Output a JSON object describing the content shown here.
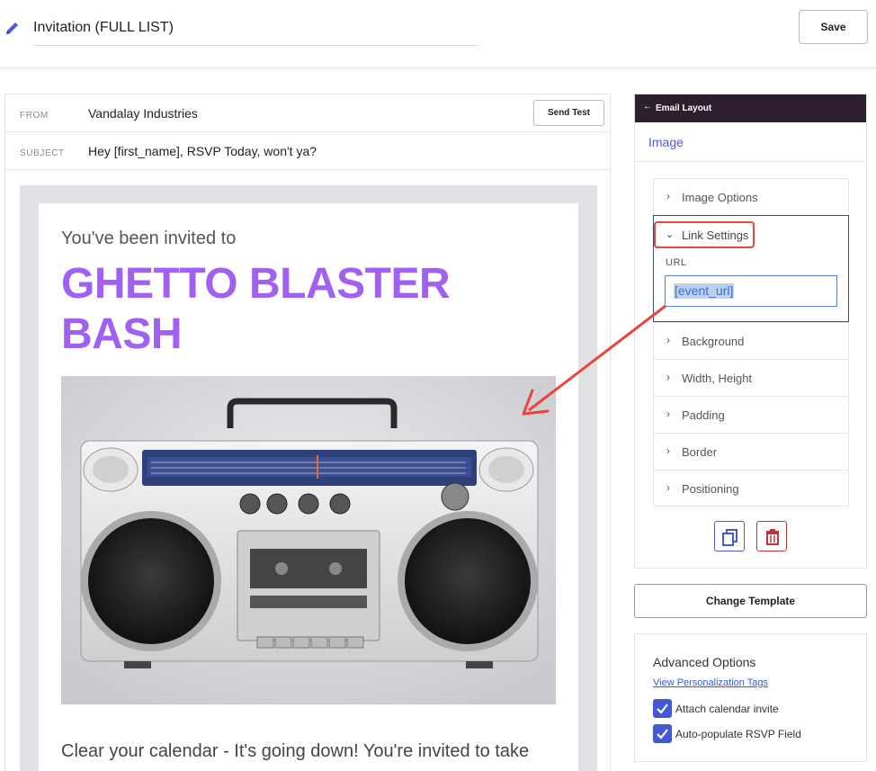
{
  "header": {
    "title": "Invitation (FULL LIST)",
    "save_label": "Save"
  },
  "email": {
    "from_label": "FROM",
    "from_value": "Vandalay Industries",
    "subject_label": "SUBJECT",
    "subject_value": "Hey [first_name], RSVP Today, won't ya?",
    "send_test_label": "Send Test"
  },
  "preview": {
    "intro": "You've been invited to",
    "headline": "GHETTO BLASTER BASH",
    "body": "Clear your calendar - It's going down! You're invited to take"
  },
  "panel": {
    "bar_label": "Email Layout",
    "back_icon": "arrow-left-icon",
    "section": "Image",
    "accordion": [
      {
        "label": "Image Options"
      },
      {
        "label": "Link Settings",
        "expanded": true
      },
      {
        "label": "Background"
      },
      {
        "label": "Width, Height"
      },
      {
        "label": "Padding"
      },
      {
        "label": "Border"
      },
      {
        "label": "Positioning"
      }
    ],
    "url_label": "URL",
    "url_value": "[event_url]"
  },
  "change_template_label": "Change Template",
  "advanced": {
    "title": "Advanced Options",
    "link": "View Personalization Tags",
    "checkboxes": [
      {
        "label": "Attach calendar invite",
        "checked": true
      },
      {
        "label": "Auto-populate RSVP Field",
        "checked": true
      }
    ]
  },
  "colors": {
    "accent": "#5a56d6",
    "headline": "#a061f0",
    "annotation": "#e8463c",
    "panel_bar": "#2d1f2b",
    "checkbox": "#4358d6"
  }
}
